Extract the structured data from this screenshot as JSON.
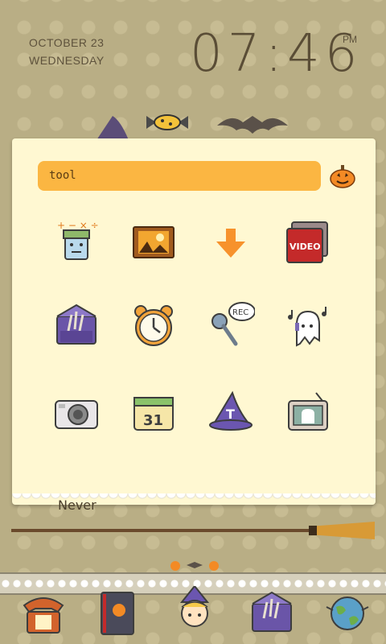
{
  "statusbar": {
    "date": "OCTOBER 23",
    "weekday": "WEDNESDAY",
    "time": "07:46",
    "ampm": "PM"
  },
  "search": {
    "query": "tool"
  },
  "apps": [
    {
      "icon": "calculator-icon"
    },
    {
      "icon": "gallery-icon"
    },
    {
      "icon": "download-icon"
    },
    {
      "icon": "video-icon"
    },
    {
      "icon": "email-icon"
    },
    {
      "icon": "alarm-clock-icon"
    },
    {
      "icon": "voice-recorder-icon",
      "badge": "REC"
    },
    {
      "icon": "music-icon"
    },
    {
      "icon": "camera-icon"
    },
    {
      "icon": "calendar-icon",
      "badge": "31"
    },
    {
      "icon": "theme-icon",
      "badge": "T"
    },
    {
      "icon": "radio-icon"
    }
  ],
  "video_label": "VIDEO",
  "widget_text": "Never",
  "dock": [
    {
      "icon": "phone-icon"
    },
    {
      "icon": "contacts-icon"
    },
    {
      "icon": "app-drawer-icon"
    },
    {
      "icon": "messages-icon"
    },
    {
      "icon": "browser-icon"
    }
  ],
  "colors": {
    "accent": "#fbb642",
    "panel": "#fff8d2",
    "wallpaper": "#b9ae85"
  }
}
